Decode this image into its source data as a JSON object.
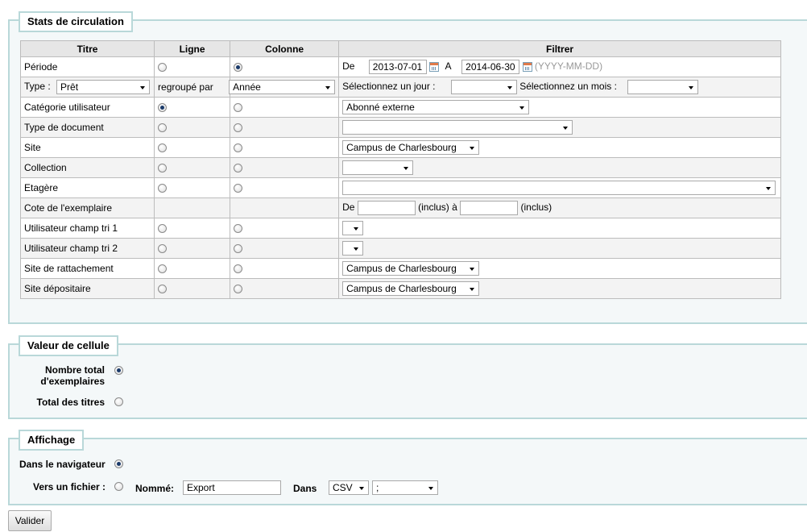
{
  "stats": {
    "legend": "Stats de circulation",
    "headers": [
      "Titre",
      "Ligne",
      "Colonne",
      "Filtrer"
    ],
    "periode": {
      "label": "Période",
      "de": "De",
      "from": "2013-07-01",
      "a": "A",
      "to": "2014-06-30",
      "format": "(YYYY-MM-DD)"
    },
    "type_row": {
      "type_label": "Type :",
      "type_value": "Prêt",
      "grouped_label": "regroupé par",
      "grouped_value": "Année",
      "day_label": "Sélectionnez un jour :",
      "month_label": "Sélectionnez un mois :"
    },
    "categorie": {
      "label": "Catégorie utilisateur",
      "filter": "Abonné externe"
    },
    "type_document": {
      "label": "Type de document"
    },
    "site": {
      "label": "Site",
      "filter": "Campus de Charlesbourg"
    },
    "collection": {
      "label": "Collection"
    },
    "etagere": {
      "label": "Etagère"
    },
    "cote": {
      "label": "Cote de l'exemplaire",
      "de": "De",
      "inclus1": "(inclus) à",
      "inclus2": "(inclus)"
    },
    "tri1": {
      "label": "Utilisateur champ tri 1"
    },
    "tri2": {
      "label": "Utilisateur champ tri 2"
    },
    "rattachement": {
      "label": "Site de rattachement",
      "filter": "Campus de Charlesbourg"
    },
    "depositaire": {
      "label": "Site dépositaire",
      "filter": "Campus de Charlesbourg"
    }
  },
  "cellule": {
    "legend": "Valeur de cellule",
    "nombre_total": "Nombre total",
    "nombre_total2": "d'exemplaires",
    "total_titres": "Total des titres"
  },
  "affichage": {
    "legend": "Affichage",
    "navigateur": "Dans le navigateur",
    "fichier": "Vers un fichier :",
    "nomme_label": "Nommé:",
    "nomme_value": "Export",
    "dans_label": "Dans",
    "format_value": "CSV",
    "separator_value": ";"
  },
  "submit": "Valider"
}
